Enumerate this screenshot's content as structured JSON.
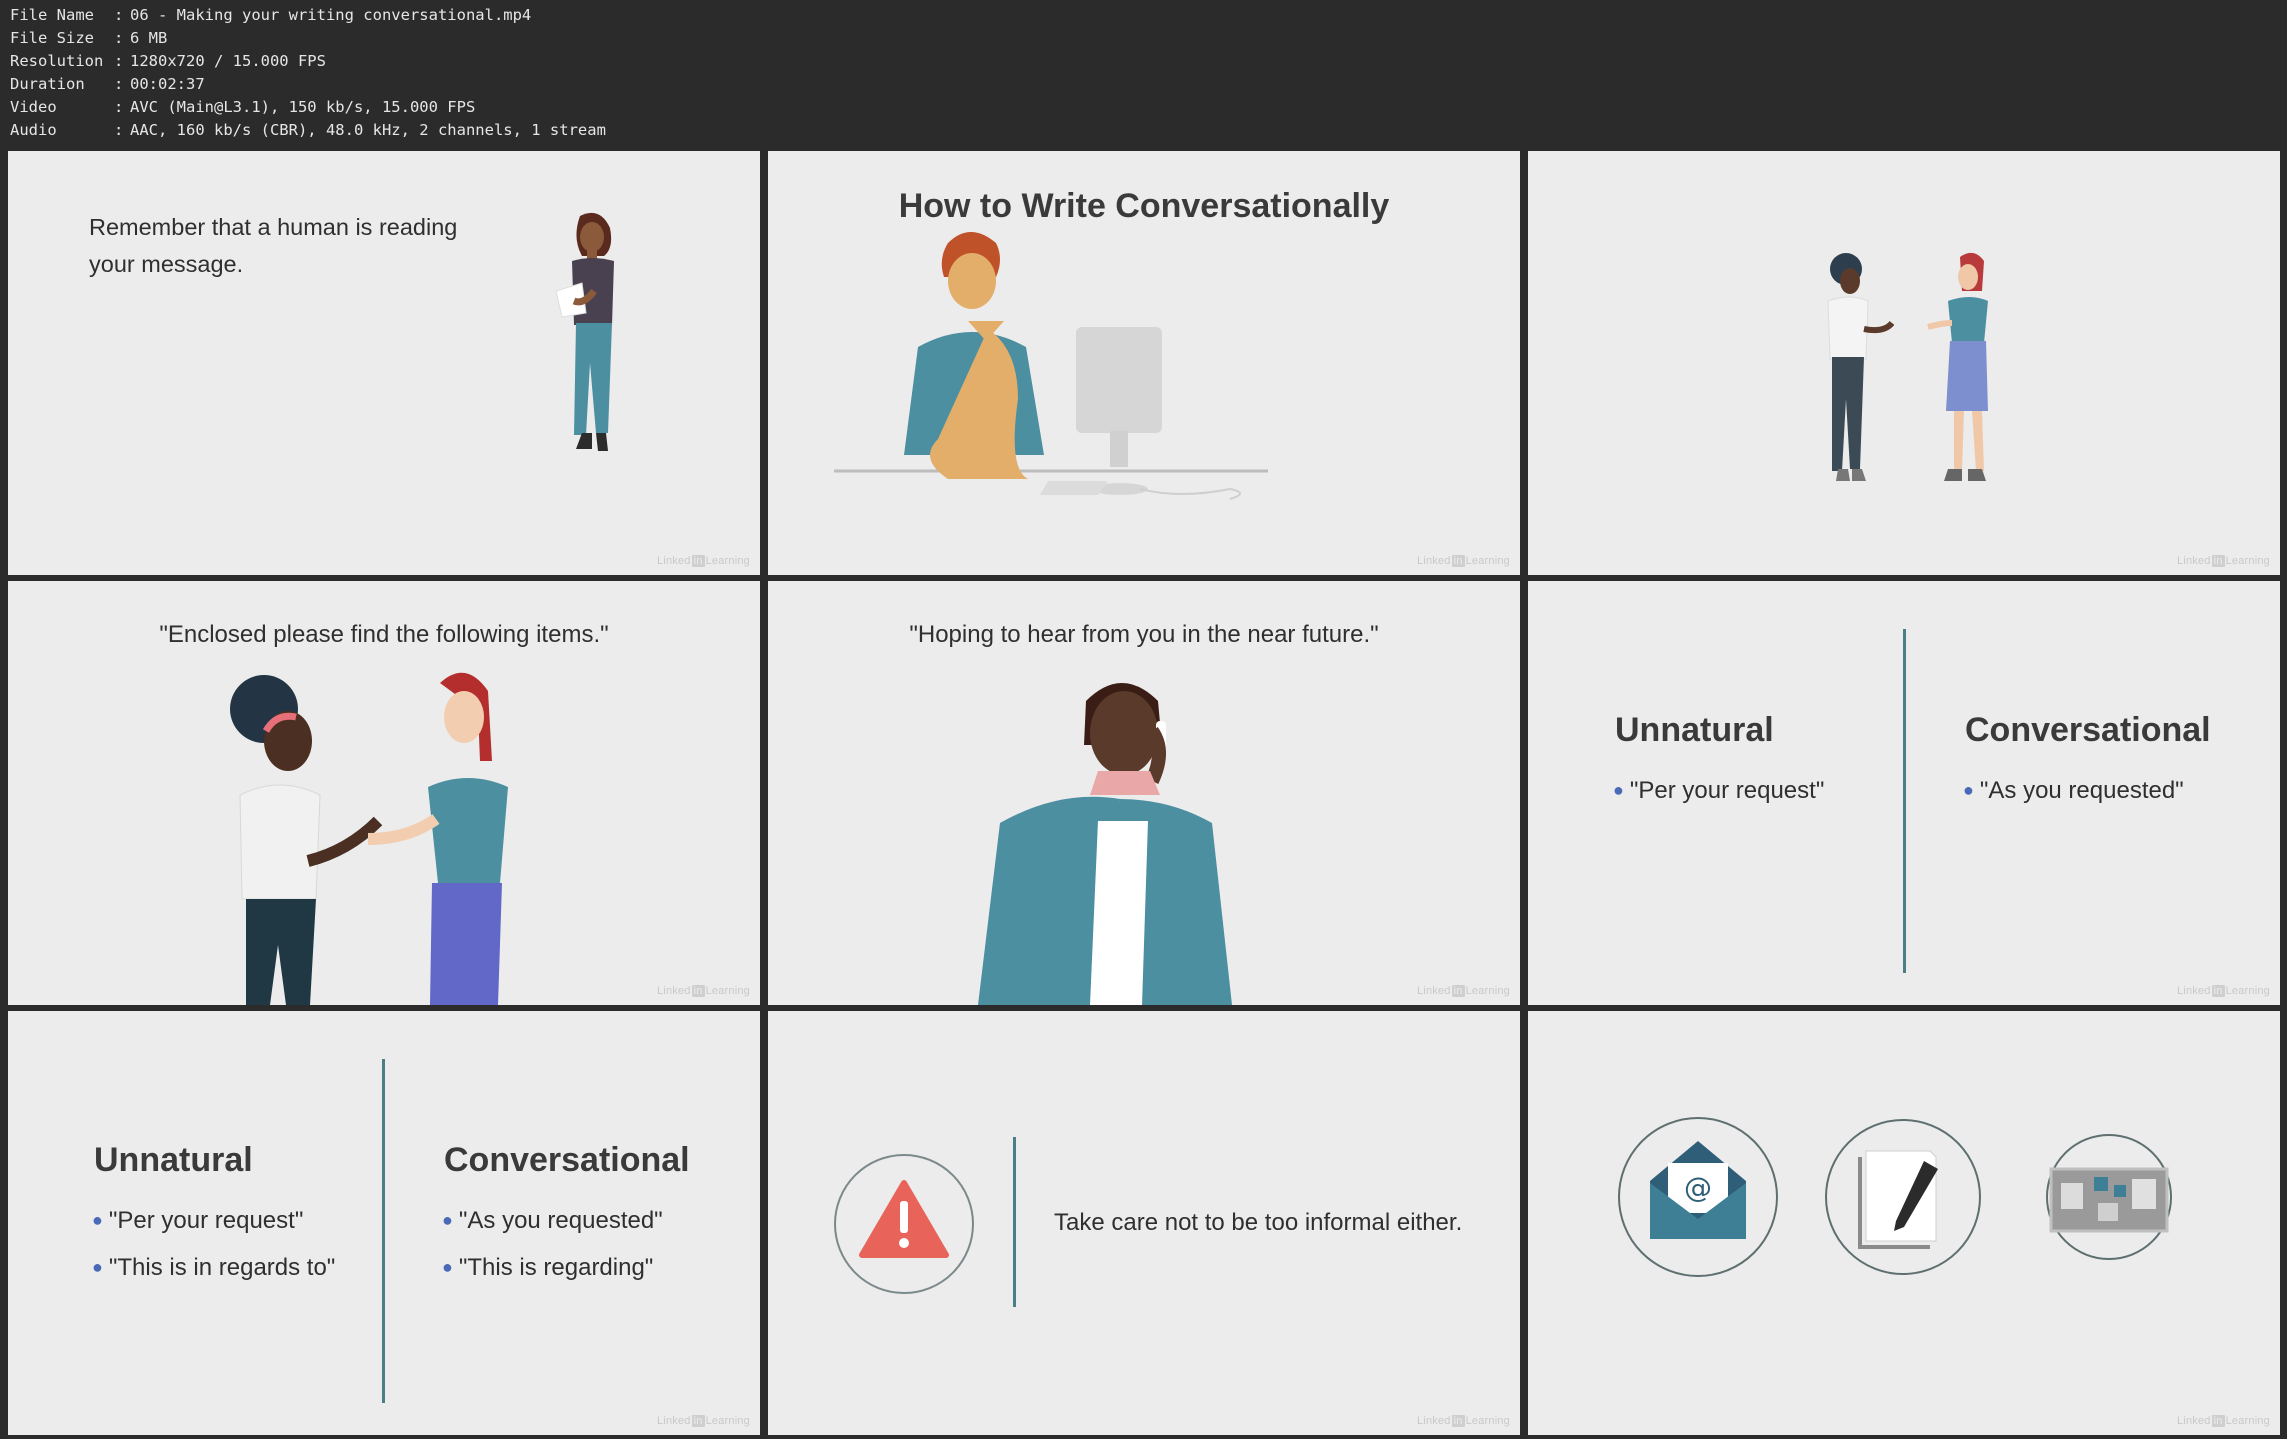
{
  "file_info": [
    {
      "key": "File Name",
      "value": "06 - Making your writing conversational.mp4"
    },
    {
      "key": "File Size",
      "value": "6 MB"
    },
    {
      "key": "Resolution",
      "value": "1280x720 / 15.000 FPS"
    },
    {
      "key": "Duration",
      "value": "00:02:37"
    },
    {
      "key": "Video",
      "value": "AVC (Main@L3.1), 150 kb/s, 15.000 FPS"
    },
    {
      "key": "Audio",
      "value": "AAC, 160 kb/s (CBR), 48.0 kHz, 2 channels, 1 stream"
    }
  ],
  "watermark": {
    "left": "Linked",
    "badge": "in",
    "right": "Learning"
  },
  "tiles": {
    "t1": {
      "text_line1": "Remember that a human is reading",
      "text_line2": "your message."
    },
    "t2": {
      "title": "How to Write Conversationally"
    },
    "t4": {
      "quote": "\"Enclosed please find the following items.\""
    },
    "t5": {
      "quote": "\"Hoping to hear from you in the near future.\""
    },
    "t6": {
      "left_heading": "Unnatural",
      "left_items": [
        "\"Per your request\""
      ],
      "right_heading": "Conversational",
      "right_items": [
        "\"As you requested\""
      ]
    },
    "t7": {
      "left_heading": "Unnatural",
      "left_items": [
        "\"Per your request\"",
        "\"This is in regards to\""
      ],
      "right_heading": "Conversational",
      "right_items": [
        "\"As you requested\"",
        "\"This is regarding\""
      ]
    },
    "t8": {
      "text": "Take care not to be too informal either.",
      "icon": "warning-icon"
    },
    "t9": {
      "icons": [
        "email-envelope-icon",
        "document-pen-icon",
        "bulletin-board-icon"
      ]
    }
  },
  "colors": {
    "accent_line": "#4b7f86",
    "bullet": "#4a6ab8",
    "warning": "#e8645a",
    "teal": "#4b8fa0"
  }
}
